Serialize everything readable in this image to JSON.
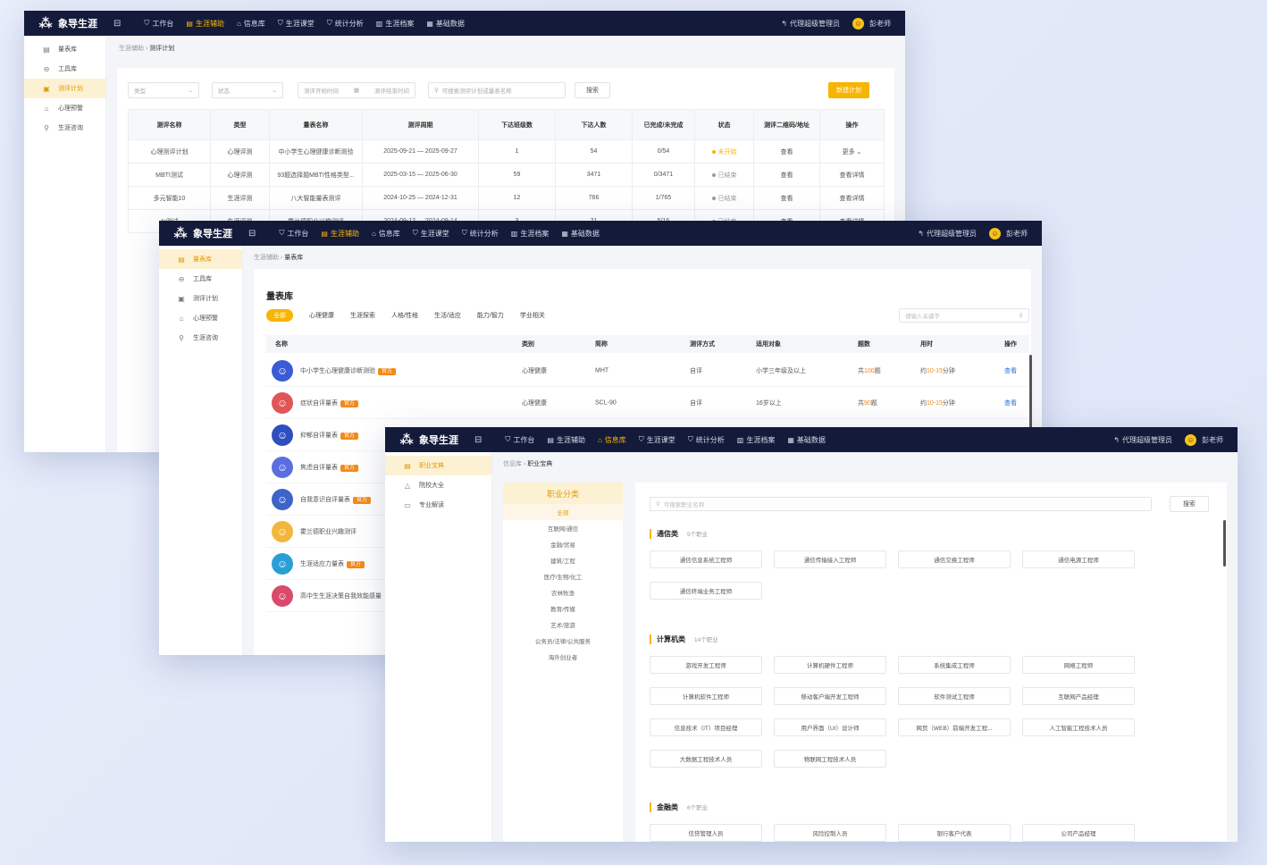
{
  "brand": "象导生涯",
  "top_nav": {
    "items": [
      "工作台",
      "生涯辅助",
      "信息库",
      "生涯课堂",
      "统计分析",
      "生涯档案",
      "基础数据"
    ],
    "switch_label": "代理超级管理员",
    "user_label": "彭老师"
  },
  "win1": {
    "sidebar": [
      "量表库",
      "工具库",
      "测评计划",
      "心理预警",
      "生涯咨询"
    ],
    "breadcrumb": {
      "parent": "生涯辅助",
      "current": "测评计划"
    },
    "filters": {
      "type": "类型",
      "status": "状态",
      "date_start": "测评开始时间",
      "date_end": "测评结束时间",
      "search": "可搜索测评计划或量表名称",
      "search_btn": "搜索",
      "new_btn": "新建计划"
    },
    "columns": [
      "测评名称",
      "类型",
      "量表名称",
      "测评周期",
      "下达班级数",
      "下达人数",
      "已完成/未完成",
      "状态",
      "测评二维码/地址",
      "操作"
    ],
    "rows": [
      {
        "name": "心理测评计划",
        "type": "心理评测",
        "scale": "中小学生心理健康诊断测验",
        "period": "2025-09-21 — 2025-09-27",
        "classes": "1",
        "people": "54",
        "done": "0/54",
        "status": "未开始",
        "qr": "查看",
        "op": "更多 ⌄",
        "status_color": "#f7b500"
      },
      {
        "name": "MBTI测试",
        "type": "心理评测",
        "scale": "93题选择题MBTI性格类型...",
        "period": "2025-03-15 — 2025-06-30",
        "classes": "59",
        "people": "3471",
        "done": "0/3471",
        "status": "已结束",
        "qr": "查看",
        "op": "查看详情",
        "status_color": "#999999"
      },
      {
        "name": "多元智能10",
        "type": "生涯评测",
        "scale": "八大智能量表测评",
        "period": "2024-10-25 — 2024-12-31",
        "classes": "12",
        "people": "766",
        "done": "1/765",
        "status": "已结束",
        "qr": "查看",
        "op": "查看详情",
        "status_color": "#999999"
      },
      {
        "name": "AI测试",
        "type": "生涯评测",
        "scale": "霍兰德职业兴趣测评",
        "period": "2024-09-12 — 2024-09-14",
        "classes": "3",
        "people": "21",
        "done": "5/16",
        "status": "已结束",
        "qr": "查看",
        "op": "查看详情",
        "status_color": "#999999"
      }
    ]
  },
  "win2": {
    "sidebar": [
      "量表库",
      "工具库",
      "测评计划",
      "心理预警",
      "生涯咨询"
    ],
    "breadcrumb": {
      "parent": "生涯辅助",
      "current": "量表库"
    },
    "title": "量表库",
    "tabs": [
      "全部",
      "心理健康",
      "生涯探索",
      "人格/性格",
      "生活/适应",
      "能力/智力",
      "学业相关"
    ],
    "search_placeholder": "请输入关键字",
    "columns": [
      "名称",
      "类别",
      "简称",
      "测评方式",
      "适用对象",
      "题数",
      "用时",
      "操作"
    ],
    "rows": [
      {
        "name": "中小学生心理健康诊断测验",
        "tag": "官方",
        "category": "心理健康",
        "abbr": "MHT",
        "mode": "自评",
        "target": "小学三年级及以上",
        "q_pre": "共",
        "q_num": "100",
        "q_post": "题",
        "t_pre": "约",
        "t_num": "10-15",
        "t_post": "分钟",
        "op": "查看",
        "color": "#3b5bd6",
        "emoji": "🙂"
      },
      {
        "name": "症状自评量表",
        "tag": "官方",
        "category": "心理健康",
        "abbr": "SCL-90",
        "mode": "自评",
        "target": "16岁以上",
        "q_pre": "共",
        "q_num": "90",
        "q_post": "题",
        "t_pre": "约",
        "t_num": "10-15",
        "t_post": "分钟",
        "op": "查看",
        "color": "#e05656",
        "emoji": "🙂"
      },
      {
        "name": "抑郁自评量表",
        "tag": "官方",
        "color": "#2f4fbf",
        "emoji": "🙂"
      },
      {
        "name": "焦虑自评量表",
        "tag": "官方",
        "color": "#5a6ee0",
        "emoji": "🙂"
      },
      {
        "name": "自我意识自评量表",
        "tag": "官方",
        "color": "#3e64c8",
        "emoji": "🙂"
      },
      {
        "name": "霍兰德职业兴趣测评",
        "tag": "",
        "color": "#f3b63c",
        "emoji": "🙂"
      },
      {
        "name": "生涯适应力量表",
        "tag": "官方",
        "color": "#2a9fd6",
        "emoji": "🙂"
      },
      {
        "name": "高中生生涯决策自我效能感量",
        "tag": "",
        "color": "#d94a6a",
        "emoji": "🙂"
      }
    ]
  },
  "win3": {
    "sidebar": [
      "职业宝典",
      "院校大全",
      "专业解读"
    ],
    "breadcrumb": {
      "parent": "信息库",
      "current": "职业宝典"
    },
    "cat_title": "职业分类",
    "categories": [
      "全部",
      "互联网/通信",
      "金融/贸易",
      "建筑/工程",
      "医疗/生物/化工",
      "农林牧渔",
      "教育/传媒",
      "艺术/旅游",
      "公务员/法律/公共服务",
      "海外创业者"
    ],
    "search_placeholder": "可搜索职业名称",
    "search_btn": "搜索",
    "sections": [
      {
        "title": "通信类",
        "count": "5个职业",
        "jobs": [
          "通信信息系统工程师",
          "通信传输接入工程师",
          "通信交换工程师",
          "通信电源工程师",
          "通信终端业务工程师"
        ]
      },
      {
        "title": "计算机类",
        "count": "14个职业",
        "jobs": [
          "游戏开发工程师",
          "计算机硬件工程师",
          "系统集成工程师",
          "网络工程师",
          "计算机软件工程师",
          "移动客户端开发工程师",
          "软件测试工程师",
          "互联网产品经理",
          "信息技术（IT）项目经理",
          "用户界面（UI）设计师",
          "网页（WEB）前端开发工程...",
          "人工智能工程技术人员",
          "大数据工程技术人员",
          "物联网工程技术人员"
        ]
      },
      {
        "title": "金融类",
        "count": "6个职业",
        "jobs": [
          "信贷管理人员",
          "风险控制人员",
          "银行客户代表",
          "公司产品经理"
        ]
      }
    ]
  }
}
